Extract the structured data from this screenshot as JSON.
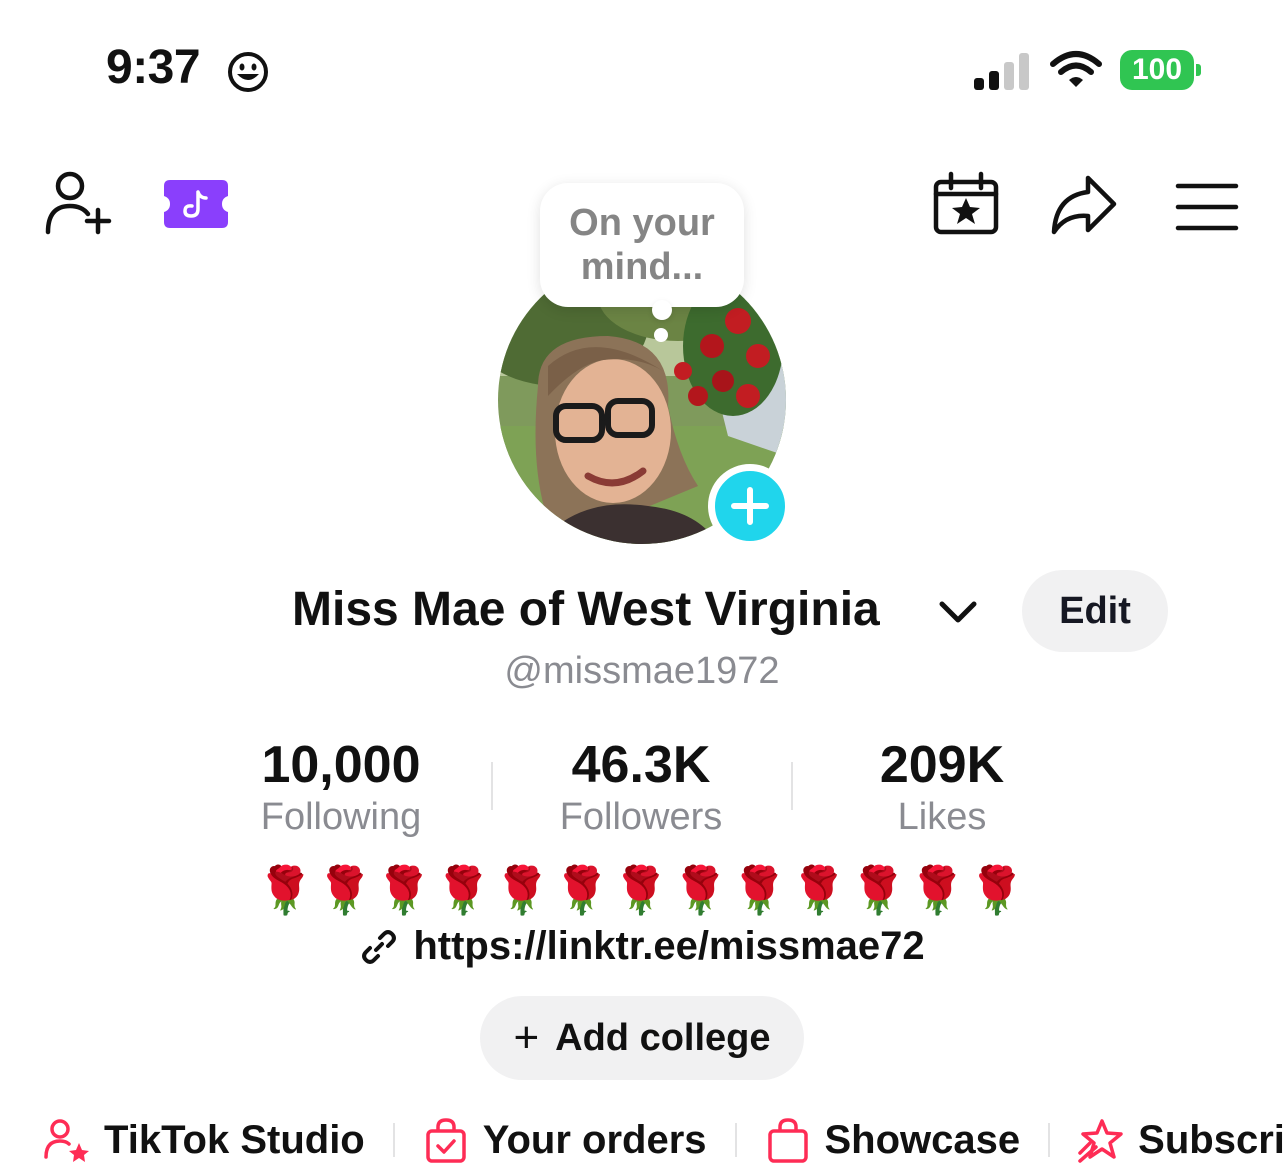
{
  "status_bar": {
    "time": "9:37",
    "battery": "100",
    "battery_color": "#30c552"
  },
  "top_bar": {
    "icons": [
      "add-friend-icon",
      "tiktok-ticket-icon",
      "calendar-star-icon",
      "share-icon",
      "menu-icon"
    ],
    "ticket_color": "#8a3ffc"
  },
  "note_bubble": {
    "text": "On your mind..."
  },
  "profile": {
    "display_name": "Miss Mae of West Virginia",
    "edit_label": "Edit",
    "username": "@missmae1972",
    "avatar_add_color": "#20d5ec"
  },
  "stats": {
    "following": {
      "value": "10,000",
      "label": "Following"
    },
    "followers": {
      "value": "46.3K",
      "label": "Followers"
    },
    "likes": {
      "value": "209K",
      "label": "Likes"
    }
  },
  "bio": {
    "text": "🌹🌹🌹🌹🌹🌹🌹🌹🌹🌹🌹🌹🌹",
    "link": "https://linktr.ee/missmae72",
    "add_college_label": "Add college"
  },
  "shortcuts": [
    {
      "label": "TikTok Studio",
      "icon": "studio-icon"
    },
    {
      "label": "Your orders",
      "icon": "orders-bag-icon"
    },
    {
      "label": "Showcase",
      "icon": "showcase-bag-icon"
    },
    {
      "label": "Subscri",
      "icon": "subscription-star-icon"
    }
  ],
  "accent_color": "#fe2c55"
}
